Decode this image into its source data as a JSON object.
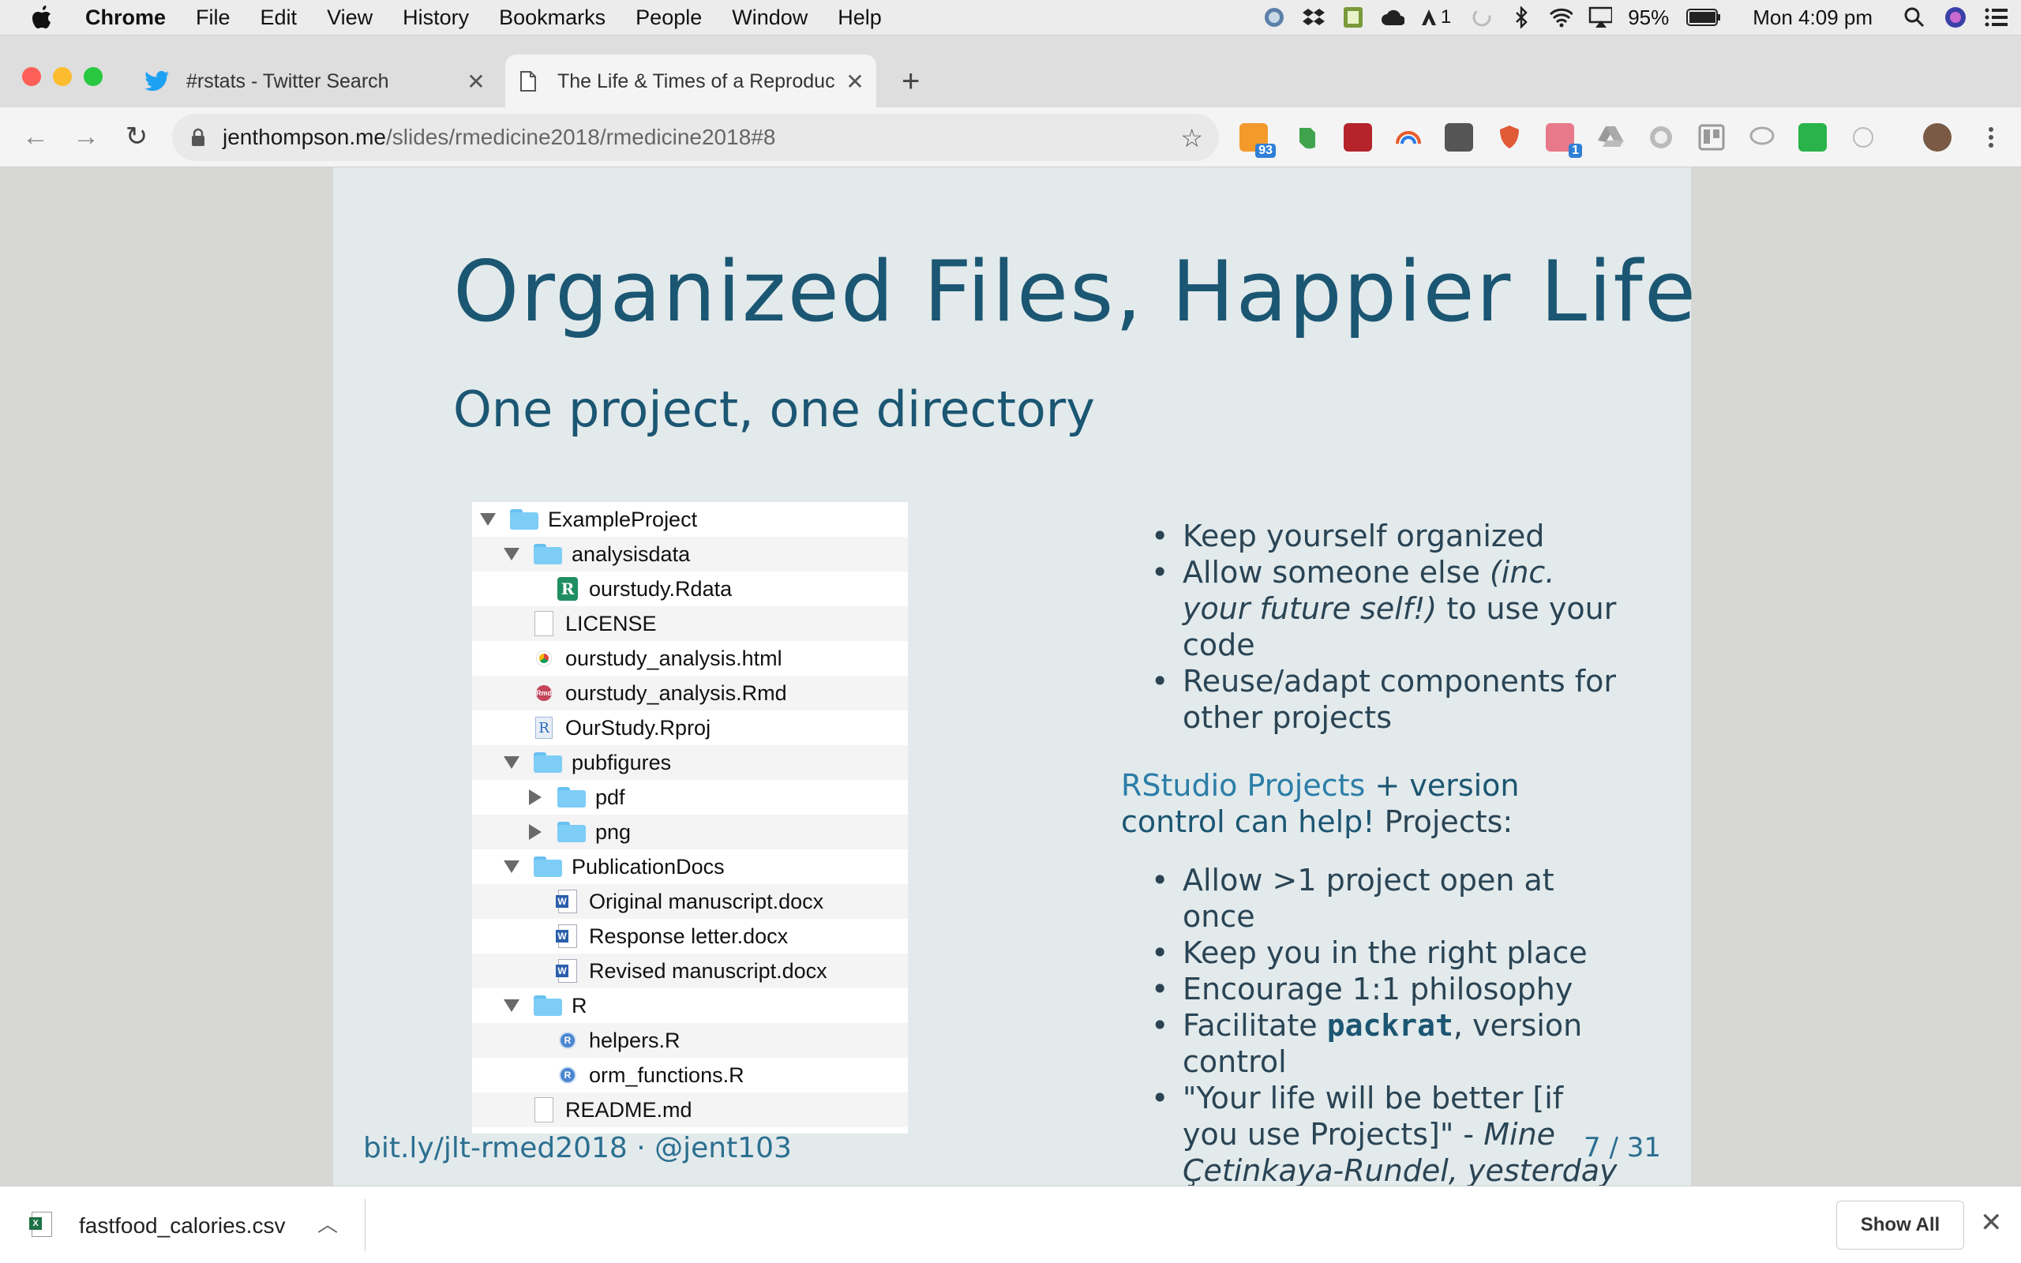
{
  "menubar": {
    "app": "Chrome",
    "items": [
      "File",
      "Edit",
      "View",
      "History",
      "Bookmarks",
      "People",
      "Window",
      "Help"
    ],
    "status": {
      "adobe_count": "1",
      "battery": "95%",
      "clock": "Mon 4:09 pm"
    }
  },
  "tabs": [
    {
      "title": "#rstats - Twitter Search",
      "icon": "twitter-icon"
    },
    {
      "title": "The Life & Times of a Reproduc",
      "icon": "page-icon"
    }
  ],
  "toolbar": {
    "url_host": "jenthompson.me",
    "url_path": "/slides/rmedicine2018/rmedicine2018#8",
    "ext_badges": {
      "rss": "93",
      "pin": "1"
    }
  },
  "slide": {
    "title": "Organized Files, Happier Life",
    "subtitle": "One project, one directory",
    "files": [
      {
        "name": "ExampleProject",
        "indent": 0,
        "tri": "down",
        "icon": "folder"
      },
      {
        "name": "analysisdata",
        "indent": 1,
        "tri": "down",
        "icon": "folder"
      },
      {
        "name": "ourstudy.Rdata",
        "indent": 2,
        "tri": "",
        "icon": "rdata"
      },
      {
        "name": "LICENSE",
        "indent": 1,
        "tri": "",
        "icon": "doc"
      },
      {
        "name": "ourstudy_analysis.html",
        "indent": 1,
        "tri": "",
        "icon": "chrome"
      },
      {
        "name": "ourstudy_analysis.Rmd",
        "indent": 1,
        "tri": "",
        "icon": "rmd"
      },
      {
        "name": "OurStudy.Rproj",
        "indent": 1,
        "tri": "",
        "icon": "rproj"
      },
      {
        "name": "pubfigures",
        "indent": 1,
        "tri": "down",
        "icon": "folder"
      },
      {
        "name": "pdf",
        "indent": 2,
        "tri": "right",
        "icon": "folder"
      },
      {
        "name": "png",
        "indent": 2,
        "tri": "right",
        "icon": "folder"
      },
      {
        "name": "PublicationDocs",
        "indent": 1,
        "tri": "down",
        "icon": "folder"
      },
      {
        "name": "Original manuscript.docx",
        "indent": 2,
        "tri": "",
        "icon": "word"
      },
      {
        "name": "Response letter.docx",
        "indent": 2,
        "tri": "",
        "icon": "word"
      },
      {
        "name": "Revised manuscript.docx",
        "indent": 2,
        "tri": "",
        "icon": "word"
      },
      {
        "name": "R",
        "indent": 1,
        "tri": "down",
        "icon": "folder"
      },
      {
        "name": "helpers.R",
        "indent": 2,
        "tri": "",
        "icon": "r"
      },
      {
        "name": "orm_functions.R",
        "indent": 2,
        "tri": "",
        "icon": "r"
      },
      {
        "name": "README.md",
        "indent": 1,
        "tri": "",
        "icon": "doc"
      }
    ],
    "bullets1": [
      "Keep yourself organized",
      "Allow someone else ",
      "Reuse/adapt components for other projects"
    ],
    "bullet1_italic": "(inc. your future self!)",
    "bullet1_tail": " to use your code",
    "rs_link": "RStudio Projects",
    "rs_mid": " + version control can help!",
    "rs_tail": " Projects:",
    "bullets2": [
      "Allow >1 project open at once",
      "Keep you in the right place",
      "Encourage 1:1 philosophy"
    ],
    "b_facilitate": "Facilitate ",
    "b_packrat": "packrat",
    "b_facilitate_tail": ", version control",
    "quote_text": "\"Your life will be better [if you use Projects]\" - ",
    "quote_author": "Mine Çetinkaya-Rundel, yesterday",
    "footer_left": "bit.ly/jlt-rmed2018 · @jent103",
    "footer_right": "7 / 31"
  },
  "download": {
    "filename": "fastfood_calories.csv",
    "show_all": "Show All"
  }
}
